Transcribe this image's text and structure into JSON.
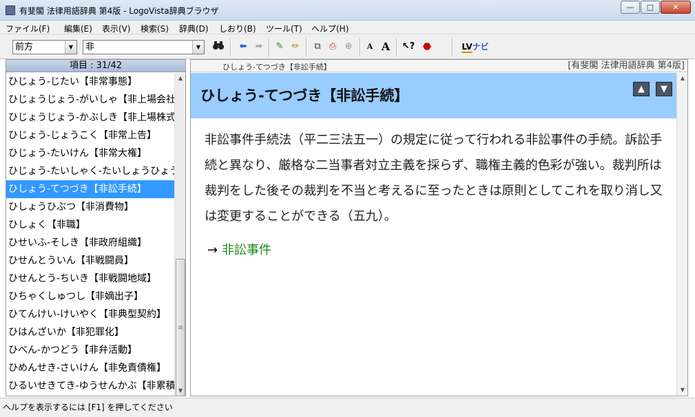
{
  "window": {
    "title": "有斐閣 法律用語辞典 第4版 - LogoVista辞典ブラウザ",
    "minimize": "—",
    "maximize": "□",
    "close": "✕"
  },
  "menu": [
    "ファイル(F)",
    "編集(E)",
    "表示(V)",
    "検索(S)",
    "辞典(D)",
    "しおり(B)",
    "ツール(T)",
    "ヘルプ(H)"
  ],
  "toolbar": {
    "mode_value": "前方",
    "search_value": "非",
    "font_small": "A",
    "font_large": "A",
    "lv_label": "LV",
    "navi_label": "ナビ"
  },
  "list_header": "項目 : 31/42",
  "items": [
    "ひじょう-じたい【非常事態】",
    "ひじょうじょう-がいしゃ【非上場会社】",
    "ひじょうじょう-かぶしき【非上場株式】",
    "ひじょう-じょうこく【非常上告】",
    "ひじょう-たいけん【非常大権】",
    "ひじょう-たいしゃく-たいしょうひょう",
    "ひしょう-てつづき【非訟手続】",
    "ひしょうひぶつ【非消費物】",
    "ひしょく【非職】",
    "ひせいふ-そしき【非政府組織】",
    "ひせんとういん【非戦闘員】",
    "ひせんとう-ちいき【非戦闘地域】",
    "ひちゃくしゅつし【非嫡出子】",
    "ひてんけい-けいやく【非典型契約】",
    "ひはんざいか【非犯罪化】",
    "ひべん-かつどう【非弁活動】",
    "ひめんせき-さいけん【非免責債権】",
    "ひるいせきてき-ゆうせんかぶ【非累積的】"
  ],
  "selected_index": 6,
  "content": {
    "breadcrumb": "ひしょう-てつづき【非訟手続】",
    "dictionary_name": "[有斐閣 法律用語辞典 第4版]",
    "entry_title": "ひしょう-てつづき【非訟手続】",
    "body": "非訟事件手続法（平二三法五一）の規定に従って行われる非訟事件の手続。訴訟手続と異なり、厳格な二当事者対立主義を採らず、職権主義的色彩が強い。裁判所は裁判をした後その裁判を不当と考えるに至ったときは原則としてこれを取り消し又は変更することができる（五九）。",
    "see_also_arrow": "→",
    "see_also_link": "非訟事件"
  },
  "status": {
    "message": "ヘルプを表示するには [F1] を押してください"
  }
}
